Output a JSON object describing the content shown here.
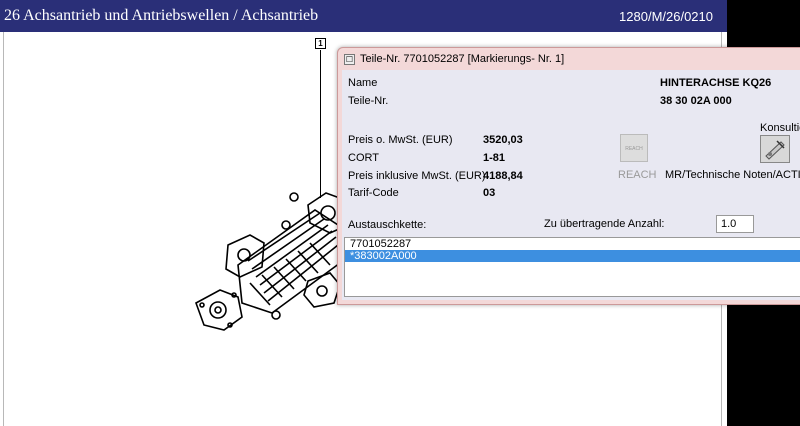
{
  "main_window": {
    "title": "26 Achsantrieb und Antriebswellen / Achsantrieb",
    "code": "1280/M/26/0210",
    "callout_marker": "1"
  },
  "dialog": {
    "title": "Teile-Nr. 7701052287 [Markierungs- Nr. 1]",
    "fields": {
      "name_label": "Name",
      "name_value": "HINTERACHSE  KQ26",
      "part_number_label": "Teile-Nr.",
      "part_number_value": "38 30 02A 000",
      "price_excl_label": "Preis o. MwSt. (EUR)",
      "price_excl_value": "3520,03",
      "cort_label": "CORT",
      "cort_value": "1-81",
      "price_incl_label": "Preis inklusive MwSt. (EUR)",
      "price_incl_value": "4188,84",
      "tariff_label": "Tarif-Code",
      "tariff_value": "03"
    },
    "consult_label": "Konsultieren",
    "reach_label": "REACH",
    "reach_icon_text": "REACH",
    "notes_label": "MR/Technische Noten/ACTIS",
    "quantity_label": "Zu übertragende Anzahl:",
    "quantity_value": "1.0",
    "exchange_chain_label": "Austauschkette:",
    "exchange_chain_items": [
      "7701052287",
      "*383002A000"
    ]
  }
}
